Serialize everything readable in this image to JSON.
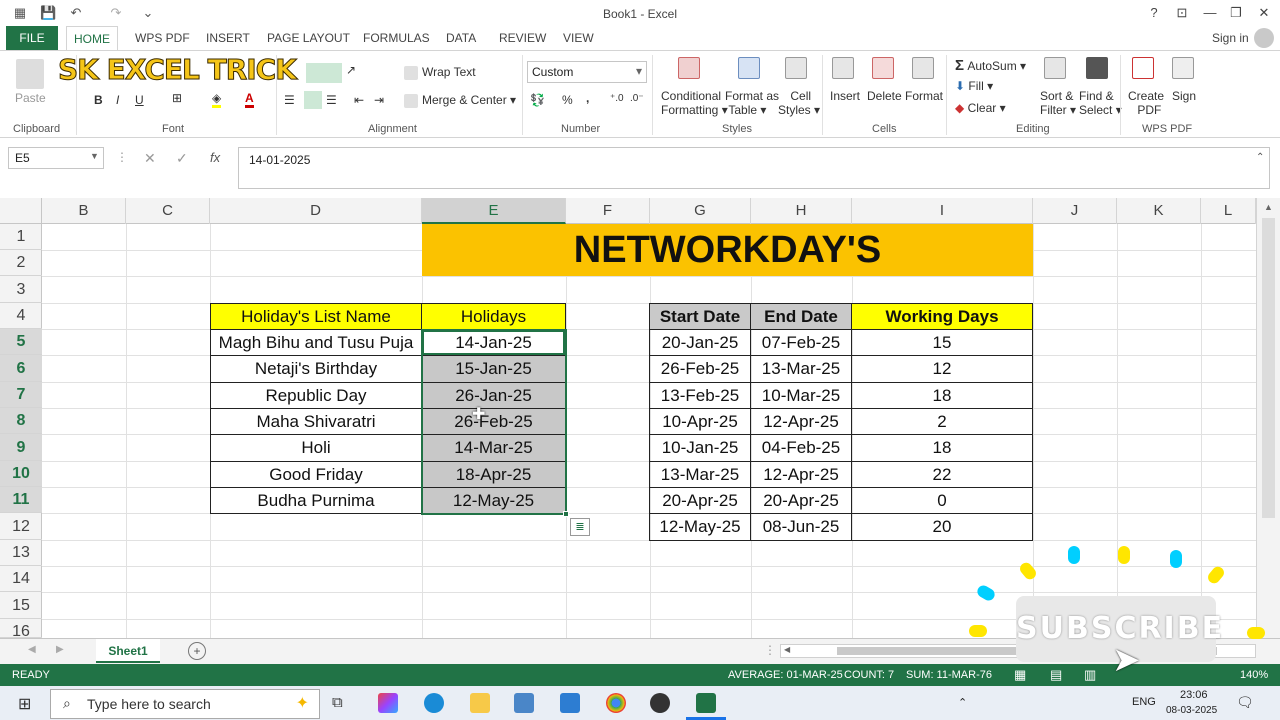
{
  "window": {
    "title": "Book1 - Excel",
    "sign_in": "Sign in",
    "help": "?",
    "minimize": "—",
    "restore": "❐",
    "close": "✕"
  },
  "ribbon": {
    "tabs": [
      "FILE",
      "HOME",
      "WPS PDF",
      "INSERT",
      "PAGE LAYOUT",
      "FORMULAS",
      "DATA",
      "REVIEW",
      "VIEW"
    ],
    "logo_text": "SK EXCEL TRICK",
    "clipboard": {
      "paste": "Paste",
      "label": "Clipboard"
    },
    "font": {
      "label": "Font",
      "bold": "B",
      "italic": "I",
      "underline": "U"
    },
    "alignment": {
      "wrap_text": "Wrap Text",
      "merge_center": "Merge & Center",
      "label": "Alignment"
    },
    "number": {
      "format_value": "Custom",
      "percent": "%",
      "comma": ",",
      "label": "Number"
    },
    "styles": {
      "conditional": "Conditional",
      "conditional2": "Formatting",
      "format_as": "Format as",
      "table": "Table",
      "cell": "Cell",
      "cell_styles": "Styles",
      "label": "Styles"
    },
    "cells": {
      "insert": "Insert",
      "delete": "Delete",
      "format": "Format",
      "label": "Cells"
    },
    "editing": {
      "autosum": "AutoSum",
      "fill": "Fill",
      "clear": "Clear",
      "sort": "Sort &",
      "filter": "Filter",
      "find": "Find &",
      "select": "Select",
      "label": "Editing"
    },
    "wps": {
      "create": "Create",
      "pdf": "PDF",
      "sign": "Sign",
      "label": "WPS PDF"
    }
  },
  "formula_bar": {
    "name_box": "E5",
    "fx": "fx",
    "value": "14-01-2025"
  },
  "grid": {
    "columns": [
      "B",
      "C",
      "D",
      "E",
      "F",
      "G",
      "H",
      "I",
      "J",
      "K",
      "L"
    ],
    "rows": [
      "1",
      "2",
      "3",
      "4",
      "5",
      "6",
      "7",
      "8",
      "9",
      "10",
      "11",
      "12",
      "13",
      "14",
      "15",
      "16"
    ],
    "banner": "NETWORKDAY'S",
    "holidays_table": {
      "headers": [
        "Holiday's  List Name",
        "Holidays"
      ],
      "rows": [
        [
          "Magh Bihu and Tusu Puja",
          "14-Jan-25"
        ],
        [
          "Netaji's Birthday",
          "15-Jan-25"
        ],
        [
          "Republic Day",
          "26-Jan-25"
        ],
        [
          "Maha Shivaratri",
          "26-Feb-25"
        ],
        [
          "Holi",
          "14-Mar-25"
        ],
        [
          "Good Friday",
          "18-Apr-25"
        ],
        [
          "Budha Purnima",
          "12-May-25"
        ]
      ]
    },
    "workdays_table": {
      "headers": [
        "Start Date",
        "End Date",
        "Working Days"
      ],
      "rows": [
        [
          "20-Jan-25",
          "07-Feb-25",
          "15"
        ],
        [
          "26-Feb-25",
          "13-Mar-25",
          "12"
        ],
        [
          "13-Feb-25",
          "10-Mar-25",
          "18"
        ],
        [
          "10-Apr-25",
          "12-Apr-25",
          "2"
        ],
        [
          "10-Jan-25",
          "04-Feb-25",
          "18"
        ],
        [
          "13-Mar-25",
          "12-Apr-25",
          "22"
        ],
        [
          "20-Apr-25",
          "20-Apr-25",
          "0"
        ],
        [
          "12-May-25",
          "08-Jun-25",
          "20"
        ]
      ]
    }
  },
  "sheets": {
    "active": "Sheet1",
    "add": "+"
  },
  "status": {
    "mode": "READY",
    "average": "AVERAGE: 01-MAR-25",
    "count": "COUNT: 7",
    "sum": "SUM: 11-MAR-76",
    "zoom": "140%"
  },
  "taskbar": {
    "search_placeholder": "Type here to search",
    "lang": "ENG",
    "time": "23:06",
    "date": "08-03-2025"
  },
  "overlay": {
    "subscribe": "SUBSCRIBE"
  },
  "colors": {
    "excel_green": "#217346",
    "yellow": "#ffff00",
    "gold": "#fbc200",
    "gray_header": "#c9c9c9",
    "selection": "#c8c8c8"
  }
}
